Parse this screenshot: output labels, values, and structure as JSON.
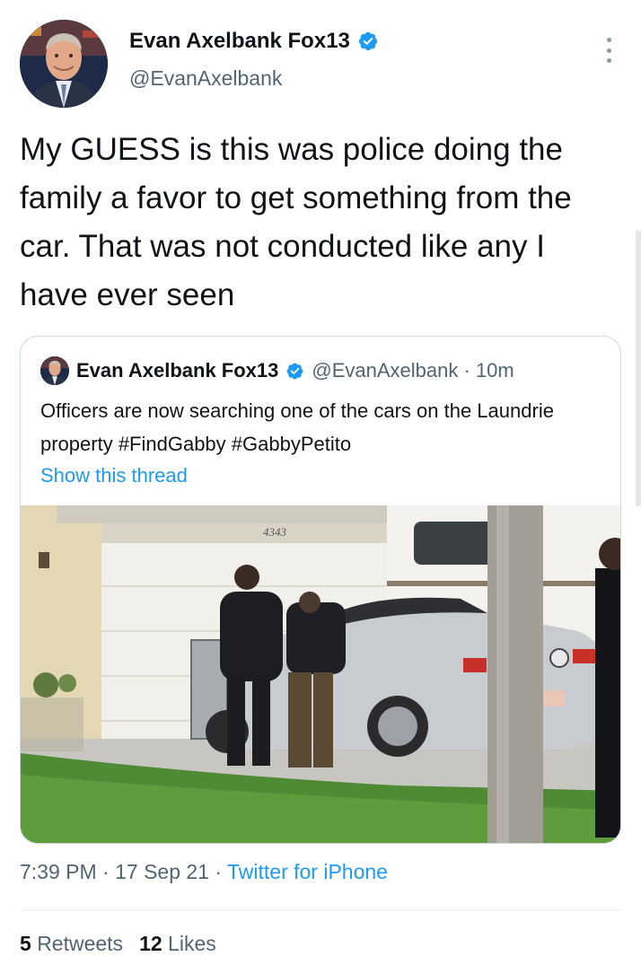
{
  "author": {
    "display_name": "Evan Axelbank Fox13",
    "handle": "@EvanAxelbank",
    "verified_icon": "verified-badge-icon",
    "more_icon": "more-vertical-icon"
  },
  "tweet": {
    "text": "My GUESS is this was police doing the family a favor to get something from the car. That was not conducted like any I have ever seen"
  },
  "quoted_tweet": {
    "display_name": "Evan Axelbank Fox13",
    "handle_time": "@EvanAxelbank · 10m",
    "text": "Officers are now searching one of the cars on the Laundrie property #FindGabby #GabbyPetito",
    "show_thread": "Show this thread",
    "photo_house_number": "4343"
  },
  "meta": {
    "time_date": "7:39 PM · 17 Sep 21 · ",
    "app": "Twitter for iPhone"
  },
  "stats": {
    "retweets_count": "5",
    "retweets_label": "Retweets",
    "likes_count": "12",
    "likes_label": "Likes"
  },
  "colors": {
    "accent": "#1d9bf0",
    "secondary_text": "#536471",
    "primary_text": "#0f1419",
    "border": "#cfd9de"
  }
}
